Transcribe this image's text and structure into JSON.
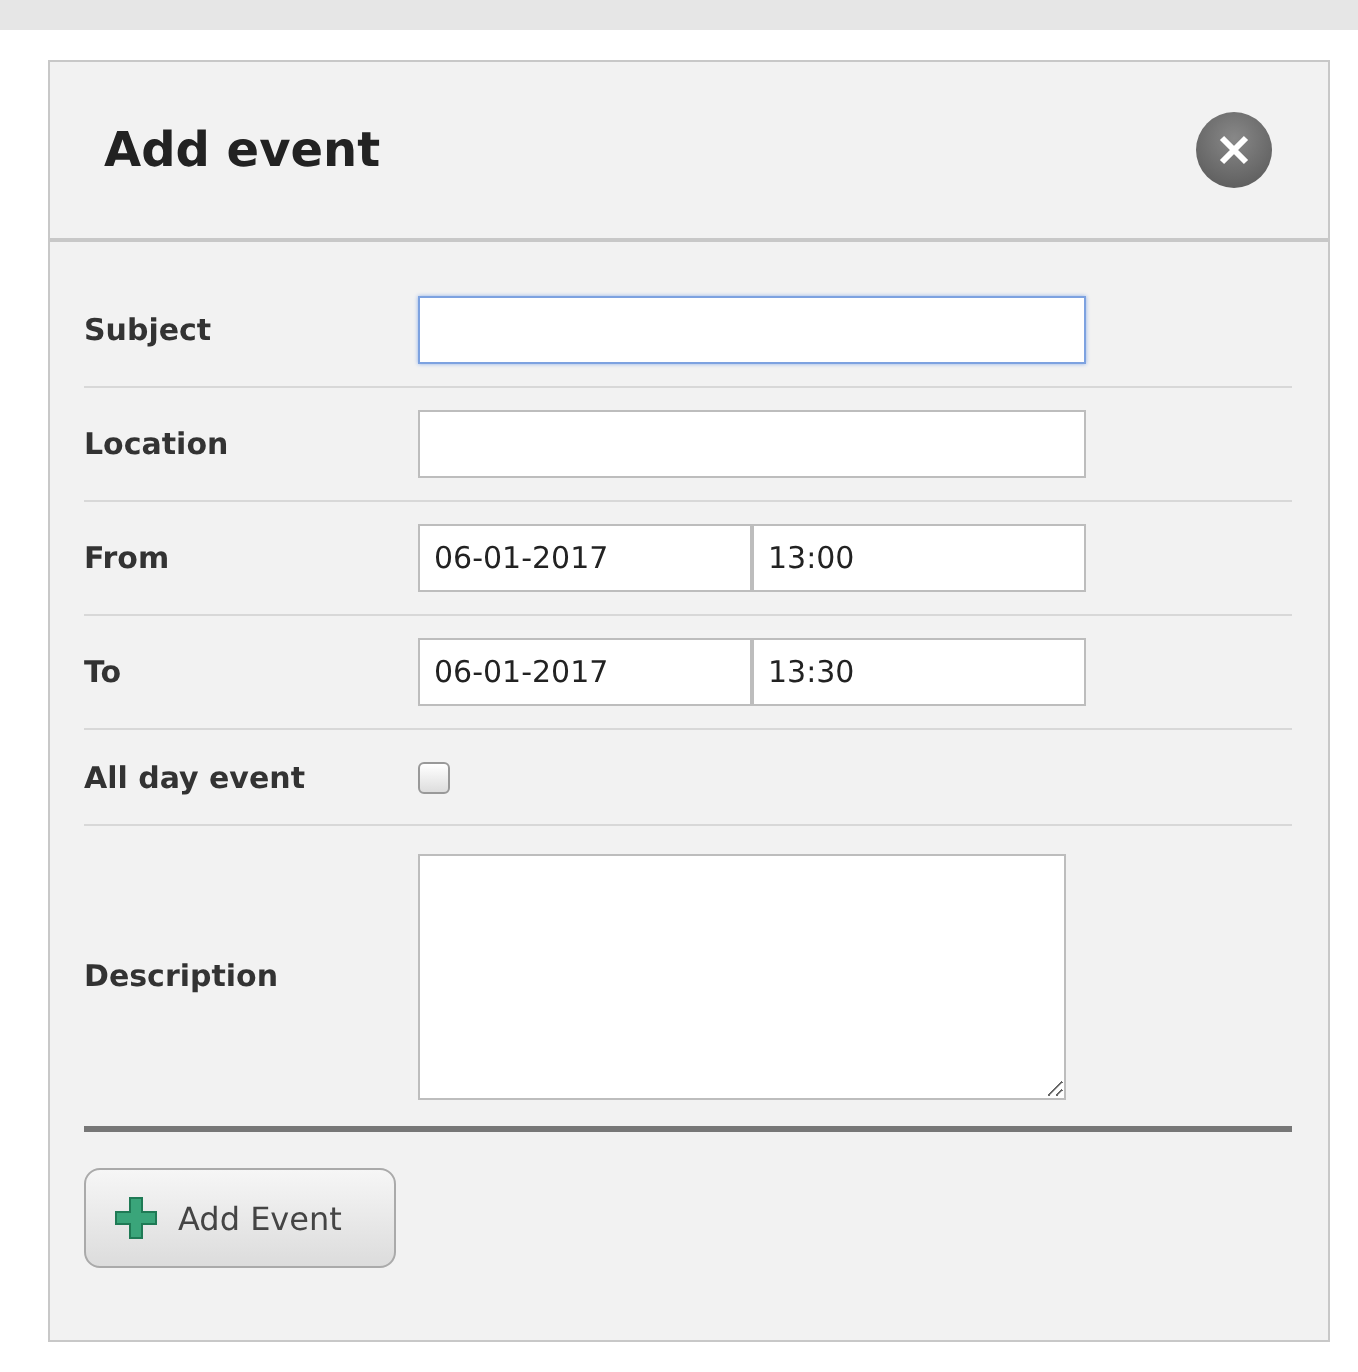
{
  "dialog": {
    "title": "Add event"
  },
  "rows": [
    {
      "kind": "text",
      "label": "Subject",
      "value": "",
      "focused": true
    },
    {
      "kind": "text",
      "label": "Location",
      "value": "",
      "focused": false
    },
    {
      "kind": "datetime",
      "label": "From",
      "date": "06-01-2017",
      "time": "13:00"
    },
    {
      "kind": "datetime",
      "label": "To",
      "date": "06-01-2017",
      "time": "13:30"
    },
    {
      "kind": "checkbox",
      "label": "All day event",
      "checked": false
    },
    {
      "kind": "textarea",
      "label": "Description",
      "value": ""
    }
  ],
  "add_button": {
    "label": "Add Event"
  }
}
